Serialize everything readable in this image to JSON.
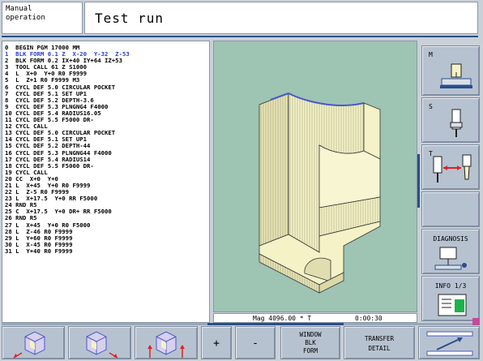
{
  "header": {
    "mode_line1": "Manual",
    "mode_line2": "operation",
    "title": "Test run"
  },
  "program_lines": [
    "0  BEGIN PGM 17000 MM",
    "1  BLK FORM 0.1 Z  X-20  Y-32  Z-53",
    "2  BLK FORM 0.2 IX+40 IY+64 IZ+53",
    "3  TOOL CALL 61 Z S1000",
    "4  L  X+0  Y+0 R0 F9999",
    "5  L  Z+1 R0 F9999 M3",
    "6  CYCL DEF 5.0 CIRCULAR POCKET",
    "7  CYCL DEF 5.1 SET UP1",
    "8  CYCL DEF 5.2 DEPTH-3.6",
    "9  CYCL DEF 5.3 PLNGNG4 F4000",
    "10 CYCL DEF 5.4 RADIUS16.05",
    "11 CYCL DEF 5.5 F5000 DR-",
    "12 CYCL CALL",
    "13 CYCL DEF 5.0 CIRCULAR POCKET",
    "14 CYCL DEF 5.1 SET UP1",
    "15 CYCL DEF 5.2 DEPTH-44",
    "16 CYCL DEF 5.3 PLNGNG44 F4000",
    "17 CYCL DEF 5.4 RADIUS14",
    "18 CYCL DEF 5.5 F5000 DR-",
    "19 CYCL CALL",
    "20 CC  X+0  Y+0",
    "21 L  X+45  Y+0 R0 F9999",
    "22 L  Z-5 R0 F9999",
    "23 L  X+17.5  Y+0 RR F5000",
    "24 RND R5",
    "25 C  X+17.5  Y+0 DR+ RR F5000",
    "26 RND R5",
    "27 L  X+45  Y+0 R0 F5000",
    "28 L  Z-46 R0 F9999",
    "29 L  Y+60 R0 F9999",
    "30 L  X-45 R0 F9999",
    "31 L  Y+40 R0 F9999"
  ],
  "active_line_index": 1,
  "status": {
    "magnification": "Mag 4096.00 * T",
    "time": "0:00:30"
  },
  "right_softkeys": [
    {
      "label": "M",
      "icon": "magnifier-workpiece-icon"
    },
    {
      "label": "S",
      "icon": "spindle-icon"
    },
    {
      "label": "T",
      "icon": "tool-change-icon"
    },
    {
      "label": "",
      "icon": ""
    },
    {
      "label": "DIAGNOSIS",
      "icon": "diagnosis-icon"
    },
    {
      "label": "INFO 1/3",
      "icon": "info-screen-icon"
    }
  ],
  "bottom_softkeys": [
    {
      "label": "",
      "icon": "cube-rotate-left-icon"
    },
    {
      "label": "",
      "icon": "cube-rotate-right-icon"
    },
    {
      "label": "",
      "icon": "cube-tilt-icon"
    },
    {
      "label": "+",
      "icon": ""
    },
    {
      "label": "-",
      "icon": ""
    },
    {
      "line1": "WINDOW",
      "line2": "BLK",
      "line3": "FORM"
    },
    {
      "line1": "TRANSFER",
      "line2": "DETAIL"
    },
    {
      "label": "",
      "icon": "transfer-arrow-icon"
    }
  ],
  "colors": {
    "active_line": "#2b3bd4",
    "graphic_bg": "#9ec4b4",
    "workpiece": "#f4f2c6",
    "accent": "#2a4f8a"
  }
}
